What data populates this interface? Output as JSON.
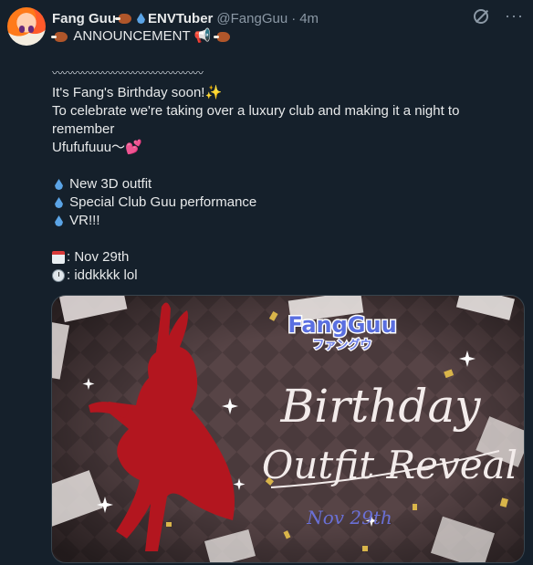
{
  "tweet": {
    "display_name": "Fang Guu",
    "suffix": "ENVTuber",
    "handle": "@FangGuu",
    "separator": "·",
    "time": "4m",
    "lines": {
      "announce": "ANNOUNCEMENT",
      "divider": "〰〰〰〰〰〰〰〰〰〰〰〰〰〰〰",
      "birthday": "It's Fang's Birthday soon!",
      "celebrate": "To celebrate we're taking over a luxury club and making it a night to remember",
      "ufu": "Ufufufuuu～",
      "item1": "New 3D outfit",
      "item2": "Special Club Guu performance",
      "item3": "VR!!!",
      "date": ": Nov 29th",
      "time_line": ": iddkkkk lol"
    }
  },
  "image": {
    "logo_top": "FangGuu",
    "logo_sub": "ファングウ",
    "title1": "Birthday",
    "title2": "Outfit Reveal",
    "date": "Nov 29th"
  },
  "icons": {
    "grok": "grok-icon",
    "more": "more-icon",
    "colors": {
      "bg": "#15202b",
      "text": "#e7e9ea",
      "muted": "#8b98a5",
      "accent_drop": "#5ba4e6"
    }
  }
}
